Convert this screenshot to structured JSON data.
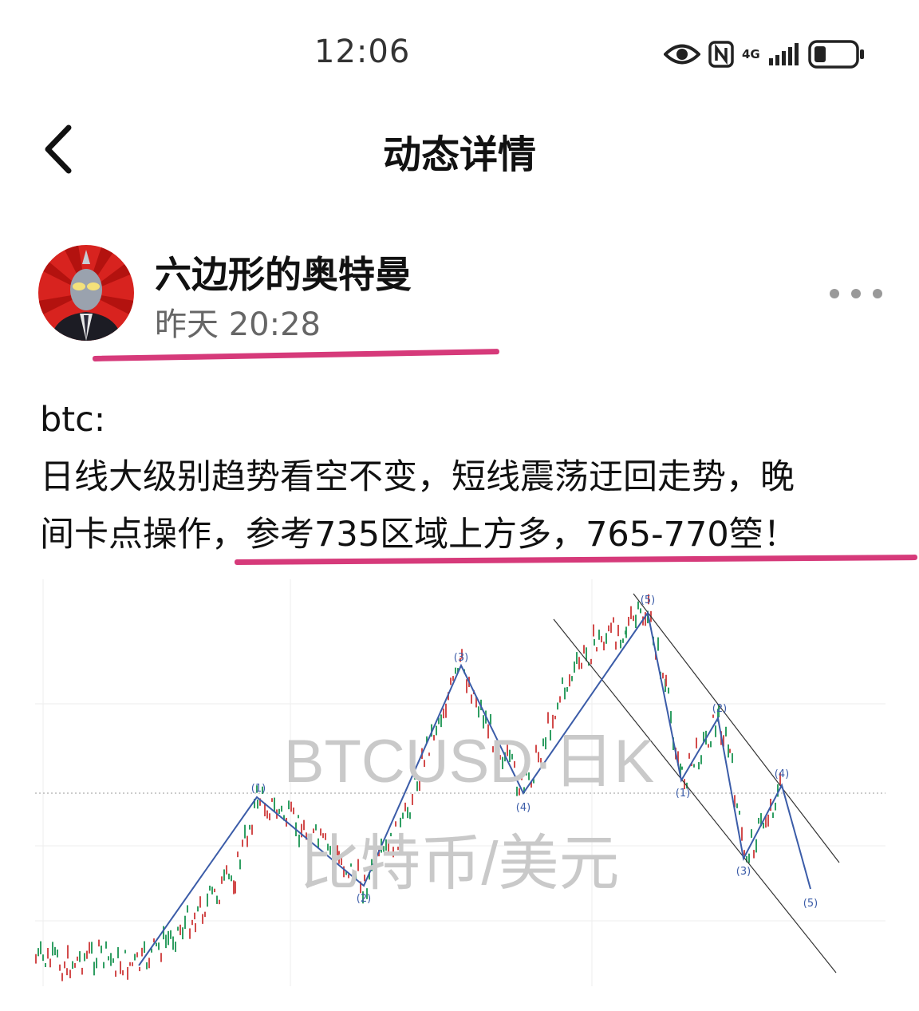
{
  "status_bar": {
    "time": "12:06",
    "network": "4G",
    "icons": [
      "eye-icon",
      "nfc-icon",
      "signal-icon",
      "battery-icon"
    ]
  },
  "header": {
    "title": "动态详情",
    "back_icon": "chevron-left-icon"
  },
  "post": {
    "author_name": "六边形的奥特曼",
    "time": "昨天 20:28",
    "more_icon": "more-dots-icon",
    "text_lines": [
      "btc:",
      "日线大级别趋势看空不变，短线震荡迂回走势，晚",
      "间卡点操作，参考735区域上方多，765-770箜！"
    ]
  },
  "chart": {
    "watermark_line1": "BTCUSD·日K",
    "watermark_line2": "比特币/美元",
    "wave_labels": [
      "(1)",
      "(2)",
      "(3)",
      "(4)",
      "(5)",
      "(1)",
      "(2)",
      "(3)",
      "(4)",
      "(5)"
    ]
  },
  "colors": {
    "accent_underline": "#d63a7a",
    "wave_line": "#3b5ca8",
    "candle_up": "#2f9e62",
    "candle_down": "#d24b4b"
  }
}
